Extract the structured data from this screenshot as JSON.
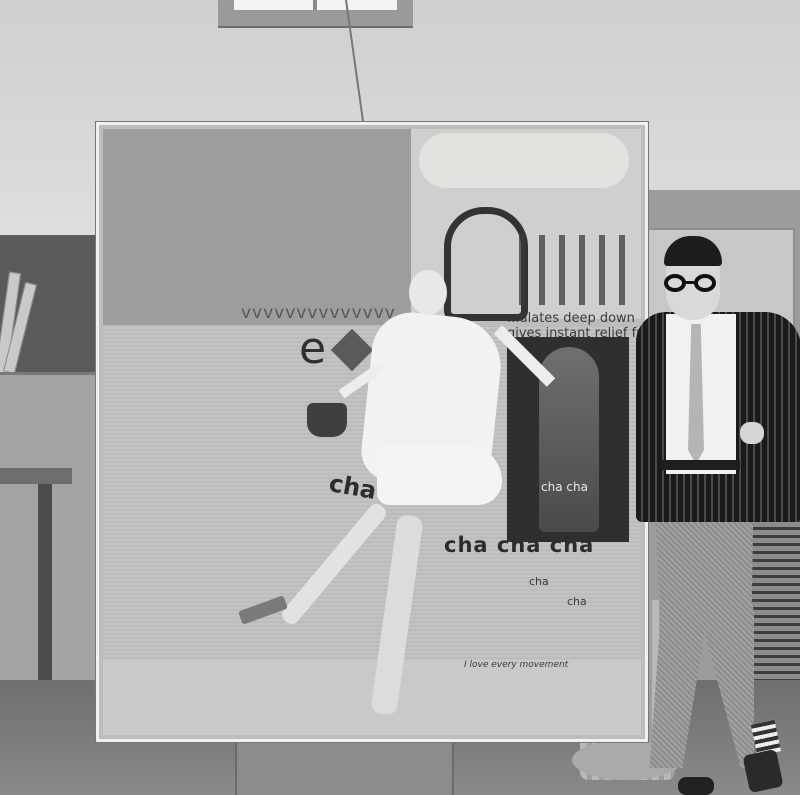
{
  "photo": {
    "description_tags": [
      "studio",
      "painting",
      "artist"
    ],
    "canvas_text": {
      "slogan_line1": "...ulates deep down",
      "slogan_line2": "gives instant relief from",
      "wavy_text": "vvvvvvvvvvvvvv",
      "letter_e": "e",
      "cha_diagonal": "cha",
      "cha_cha_cha": "cha cha cha",
      "cha_small_1": "cha",
      "cha_small_2": "cha",
      "photo_caption": "cha cha",
      "love_note": "I love every movement"
    }
  }
}
